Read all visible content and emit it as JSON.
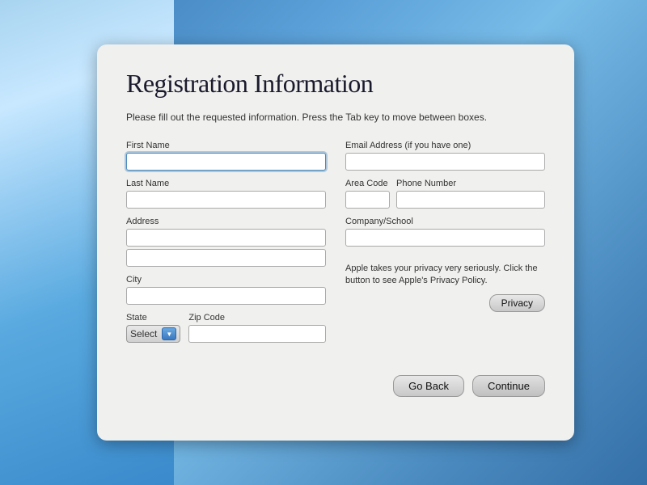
{
  "page": {
    "title": "Registration Information",
    "instructions": "Please fill out the requested information. Press the Tab key to move\nbetween boxes."
  },
  "form": {
    "fields": {
      "first_name": {
        "label": "First Name",
        "value": "",
        "placeholder": ""
      },
      "last_name": {
        "label": "Last Name",
        "value": "",
        "placeholder": ""
      },
      "address1": {
        "label": "Address",
        "value": "",
        "placeholder": ""
      },
      "address2": {
        "label": "",
        "value": "",
        "placeholder": ""
      },
      "city": {
        "label": "City",
        "value": "",
        "placeholder": ""
      },
      "state": {
        "label": "State",
        "value": "Select"
      },
      "zip": {
        "label": "Zip Code",
        "value": "",
        "placeholder": ""
      },
      "email": {
        "label": "Email Address (if you have one)",
        "value": "",
        "placeholder": ""
      },
      "area_code": {
        "label": "Area Code",
        "value": "",
        "placeholder": ""
      },
      "phone": {
        "label": "Phone Number",
        "value": "",
        "placeholder": ""
      },
      "company": {
        "label": "Company/School",
        "value": "",
        "placeholder": ""
      }
    },
    "privacy": {
      "text": "Apple takes your privacy very seriously. Click\nthe button to see Apple's Privacy Policy.",
      "button_label": "Privacy"
    }
  },
  "buttons": {
    "go_back": "Go Back",
    "continue": "Continue"
  }
}
